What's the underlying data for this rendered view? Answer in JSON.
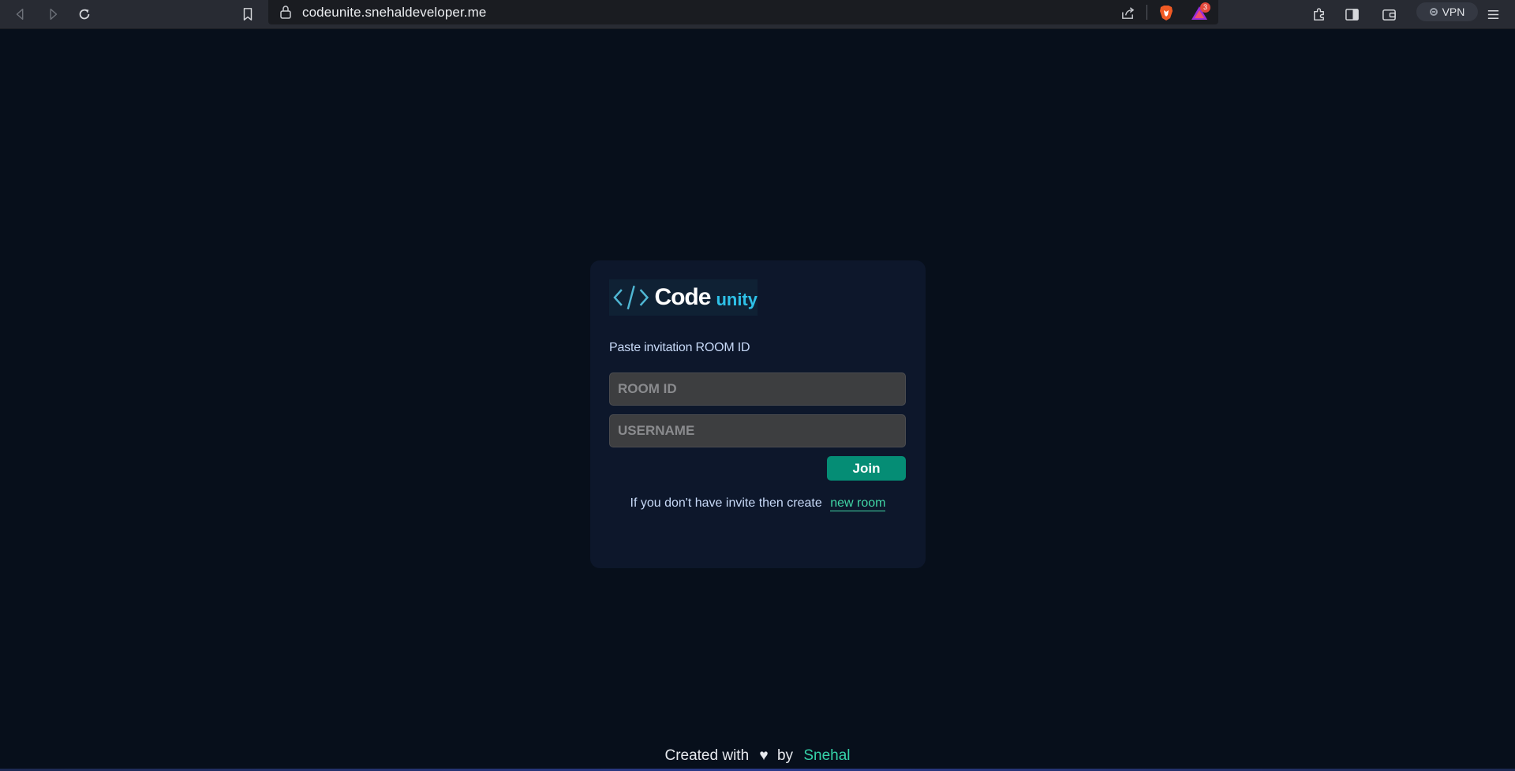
{
  "browser": {
    "url": "codeunite.snehaldeveloper.me",
    "vpn_label": "VPN",
    "brave_rewards_count": "3",
    "icons": {
      "back": "back-arrow-icon",
      "forward": "forward-arrow-icon",
      "reload": "reload-icon",
      "bookmark": "bookmark-icon",
      "lock": "lock-icon",
      "share": "share-icon",
      "brave_shields": "brave-lion-icon",
      "brave_rewards": "brave-triangle-icon",
      "extensions": "puzzle-icon",
      "sidebar": "sidebar-icon",
      "wallet": "wallet-icon",
      "menu": "hamburger-menu-icon"
    }
  },
  "logo": {
    "glyph": "</>",
    "code_text": "Code",
    "unity_text": "unity"
  },
  "form": {
    "heading": "Paste invitation ROOM ID",
    "room_placeholder": "ROOM ID",
    "username_placeholder": "USERNAME",
    "join_label": "Join",
    "create_prefix": "If you don't have invite then create",
    "create_link": "new room"
  },
  "footer": {
    "prefix": "Created with",
    "heart": "♥",
    "by": "by",
    "author": "Snehal"
  },
  "colors": {
    "page_bg": "#070f1b",
    "card_bg": "#0d172b",
    "accent_green": "#058d75",
    "link_green": "#41d6a6",
    "logo_cyan": "#2ec1e8"
  }
}
